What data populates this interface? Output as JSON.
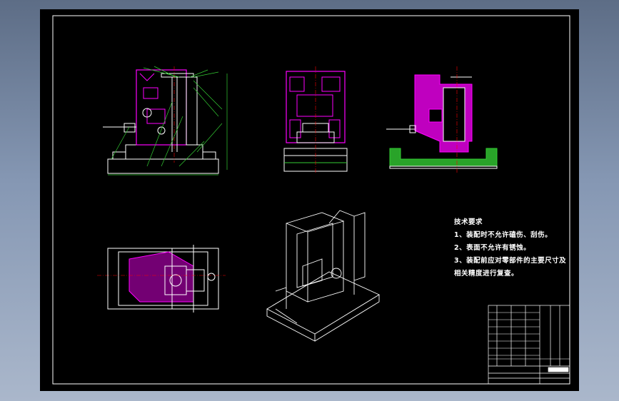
{
  "drawing": {
    "notes_title": "技术要求",
    "notes": [
      "1、装配时不允许磕伤、刮伤。",
      "2、表面不允许有锈蚀。",
      "3、装配前应对零部件的主要尺寸及",
      "相关精度进行复查。"
    ]
  },
  "colors": {
    "background": "#000000",
    "outline": "#ffffff",
    "section_magenta": "#ff00ff",
    "section_green": "#33cc33",
    "dimension_green": "#33cc33",
    "centerline_red": "#ff0000"
  }
}
